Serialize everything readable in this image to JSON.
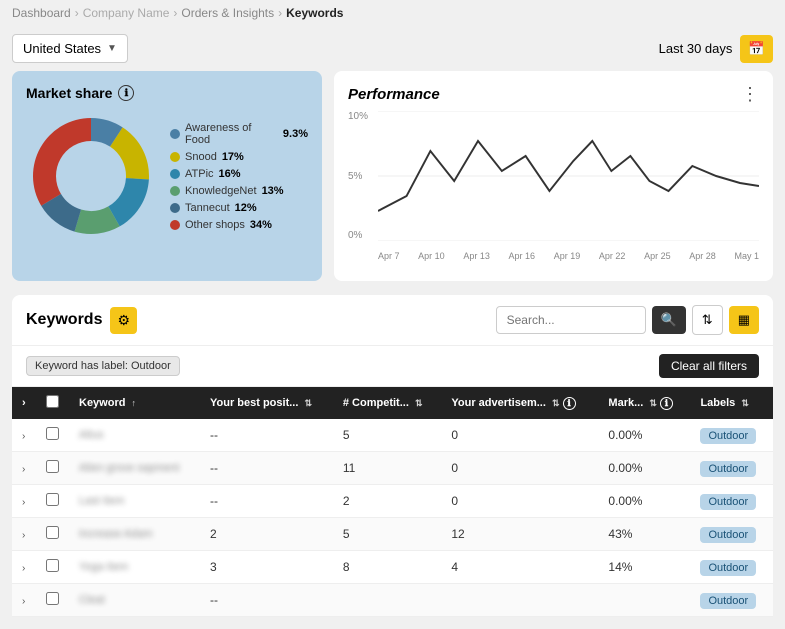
{
  "breadcrumb": {
    "items": [
      "Dashboard",
      "Company Name",
      "Orders & Insights",
      "Keywords"
    ]
  },
  "topbar": {
    "country": "United States",
    "date_range": "Last 30 days",
    "calendar_icon": "📅"
  },
  "market_share": {
    "title": "Market share",
    "legend": [
      {
        "label": "Awareness of Food",
        "pct": "9.3%",
        "color": "#4a7fa5"
      },
      {
        "label": "Snood",
        "pct": "17%",
        "color": "#c8b400"
      },
      {
        "label": "ATPic",
        "pct": "16%",
        "color": "#2e86ab"
      },
      {
        "label": "KnowledgeNet",
        "pct": "13%",
        "color": "#5a9e6f"
      },
      {
        "label": "Tannecut",
        "pct": "12%",
        "color": "#3d6b8a"
      },
      {
        "label": "Other shops",
        "pct": "34%",
        "color": "#c0392b"
      }
    ],
    "donut_segments": [
      {
        "color": "#4a7fa5",
        "pct": 9.3
      },
      {
        "color": "#c8b400",
        "pct": 17
      },
      {
        "color": "#2e86ab",
        "pct": 16
      },
      {
        "color": "#5a9e6f",
        "pct": 13
      },
      {
        "color": "#3d6b8a",
        "pct": 12
      },
      {
        "color": "#c0392b",
        "pct": 34
      }
    ]
  },
  "performance": {
    "title": "Performance",
    "y_labels": [
      "10%",
      "5%",
      "0%"
    ],
    "x_labels": [
      "Apr 7",
      "Apr 10",
      "Apr 13",
      "Apr 16",
      "Apr 19",
      "Apr 22",
      "Apr 25",
      "Apr 28",
      "May 1"
    ]
  },
  "keywords_section": {
    "title": "Keywords",
    "search_placeholder": "Search...",
    "filter_tag": "Keyword has label: Outdoor",
    "clear_filters": "Clear all filters",
    "table": {
      "headers": [
        "",
        "Keyword ↑",
        "Your best posit... ÷",
        "# Competit... ÷",
        "Your advertisem... ÷",
        "Mark... ÷",
        "Labels ÷"
      ],
      "rows": [
        {
          "keyword": "Altus",
          "best_pos": "--",
          "competitors": "5",
          "your_adv": "0",
          "market": "0.00%",
          "label": "Outdoor"
        },
        {
          "keyword": "Alien grove sapment",
          "best_pos": "--",
          "competitors": "11",
          "your_adv": "0",
          "market": "0.00%",
          "label": "Outdoor"
        },
        {
          "keyword": "Last Item",
          "best_pos": "--",
          "competitors": "2",
          "your_adv": "0",
          "market": "0.00%",
          "label": "Outdoor"
        },
        {
          "keyword": "Increase Adam",
          "best_pos": "2",
          "competitors": "5",
          "your_adv": "12",
          "market": "43%",
          "label": "Outdoor"
        },
        {
          "keyword": "Yoga Item",
          "best_pos": "3",
          "competitors": "8",
          "your_adv": "4",
          "market": "14%",
          "label": "Outdoor"
        },
        {
          "keyword": "Cleat",
          "best_pos": "",
          "competitors": "",
          "your_adv": "",
          "market": "",
          "label": "Outdoor"
        }
      ]
    }
  }
}
